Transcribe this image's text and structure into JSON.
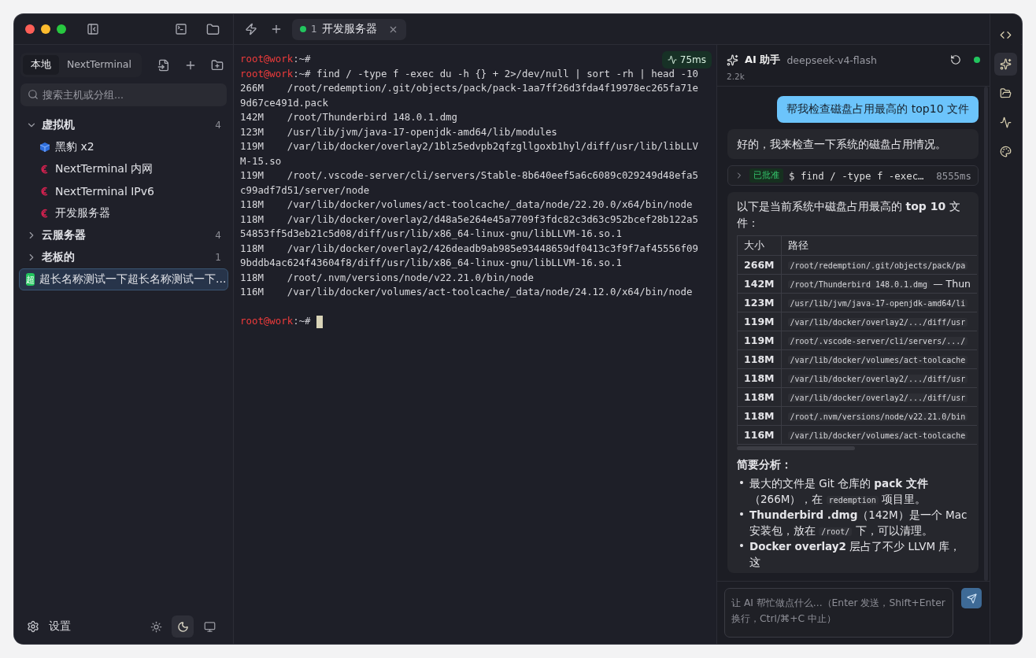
{
  "titlebar": {
    "tabs": [
      {
        "number": "1",
        "title": "开发服务器",
        "connected": true,
        "selected": true
      }
    ]
  },
  "sidebar": {
    "tabs": [
      {
        "label": "本地",
        "selected": true
      },
      {
        "label": "NextTerminal",
        "selected": false
      }
    ],
    "search": {
      "placeholder": "搜索主机或分组..."
    },
    "tree": [
      {
        "kind": "group",
        "label": "虚拟机",
        "count": "4",
        "expanded": true,
        "children": [
          {
            "kind": "cube",
            "label": "黑豹 x2",
            "selected": false
          },
          {
            "kind": "swirl",
            "label": "NextTerminal 内网",
            "selected": false
          },
          {
            "kind": "swirl",
            "label": "NextTerminal IPv6",
            "selected": false
          },
          {
            "kind": "swirl",
            "label": "开发服务器",
            "selected": false
          }
        ]
      },
      {
        "kind": "group",
        "label": "云服务器",
        "count": "4",
        "expanded": false
      },
      {
        "kind": "group",
        "label": "老板的",
        "count": "1",
        "expanded": false
      },
      {
        "kind": "badge",
        "badge": "超",
        "label": "超长名称测试一下超长名称测试一下...",
        "selected": true
      }
    ],
    "settings": "设置",
    "themes": [
      {
        "kind": "light",
        "selected": false
      },
      {
        "kind": "dark",
        "selected": true
      },
      {
        "kind": "system",
        "selected": false
      }
    ]
  },
  "terminal": {
    "latency": "75ms",
    "lines": [
      {
        "kind": "prompt",
        "user": "root@work",
        "path": ":~#"
      },
      {
        "kind": "prompt",
        "user": "root@work",
        "path": ":~#",
        "command": " find / -type f -exec du -h {} + 2>/dev/null | sort -rh | head -10"
      },
      {
        "kind": "output",
        "text": "266M    /root/redemption/.git/objects/pack/pack-1aa7ff26d3fda4f19978ec265fa71e"
      },
      {
        "kind": "output",
        "text": "9d67ce491d.pack"
      },
      {
        "kind": "output",
        "text": "142M    /root/Thunderbird 148.0.1.dmg"
      },
      {
        "kind": "output",
        "text": "123M    /usr/lib/jvm/java-17-openjdk-amd64/lib/modules"
      },
      {
        "kind": "output",
        "text": "119M    /var/lib/docker/overlay2/1blz5edvpb2qfzgllgoxb1hyl/diff/usr/lib/libLLV"
      },
      {
        "kind": "output",
        "text": "M-15.so"
      },
      {
        "kind": "output",
        "text": "119M    /root/.vscode-server/cli/servers/Stable-8b640eef5a6c6089c029249d48efa5"
      },
      {
        "kind": "output",
        "text": "c99adf7d51/server/node"
      },
      {
        "kind": "output",
        "text": "118M    /var/lib/docker/volumes/act-toolcache/_data/node/22.20.0/x64/bin/node"
      },
      {
        "kind": "output",
        "text": "118M    /var/lib/docker/overlay2/d48a5e264e45a7709f3fdc82c3d63c952bcef28b122a5"
      },
      {
        "kind": "output",
        "text": "54853ff5d3eb21c5d08/diff/usr/lib/x86_64-linux-gnu/libLLVM-16.so.1"
      },
      {
        "kind": "output",
        "text": "118M    /var/lib/docker/overlay2/426deadb9ab985e93448659df0413c3f9f7af45556f09"
      },
      {
        "kind": "output",
        "text": "9bddb4ac624f43604f8/diff/usr/lib/x86_64-linux-gnu/libLLVM-16.so.1"
      },
      {
        "kind": "output",
        "text": "118M    /root/.nvm/versions/node/v22.21.0/bin/node"
      },
      {
        "kind": "output",
        "text": "116M    /var/lib/docker/volumes/act-toolcache/_data/node/24.12.0/x64/bin/node"
      },
      {
        "kind": "blank"
      },
      {
        "kind": "prompt",
        "user": "root@work",
        "path": ":~#",
        "cursor": true
      }
    ]
  },
  "assistant": {
    "title": "AI 助手",
    "model": "deepseek-v4-flash",
    "online": true,
    "tokens": "2.2k",
    "messages": [
      {
        "kind": "user",
        "text": "帮我检查磁盘占用最高的 top10 文件"
      },
      {
        "kind": "assistant",
        "text": "好的，我来检查一下系统的磁盘占用情况。"
      },
      {
        "kind": "tool",
        "status": "已批准",
        "command": "$ find / -type f -exec…",
        "duration": "8555ms",
        "expanded": false
      },
      {
        "kind": "answer",
        "intro": "以下是当前系统中磁盘占用最高的 **top 10** 文件：",
        "table": {
          "columns": [
            "大小",
            "路径"
          ],
          "rows": [
            {
              "size": "266M",
              "path": "/root/redemption/.git/objects/pack/pa"
            },
            {
              "size": "142M",
              "path": "/root/Thunderbird 148.0.1.dmg",
              "note": "— Thun"
            },
            {
              "size": "123M",
              "path": "/usr/lib/jvm/java-17-openjdk-amd64/li"
            },
            {
              "size": "119M",
              "path": "/var/lib/docker/overlay2/.../diff/usr"
            },
            {
              "size": "119M",
              "path": "/root/.vscode-server/cli/servers/.../"
            },
            {
              "size": "118M",
              "path": "/var/lib/docker/volumes/act-toolcache"
            },
            {
              "size": "118M",
              "path": "/var/lib/docker/overlay2/.../diff/usr"
            },
            {
              "size": "118M",
              "path": "/var/lib/docker/overlay2/.../diff/usr"
            },
            {
              "size": "118M",
              "path": "/root/.nvm/versions/node/v22.21.0/bin"
            },
            {
              "size": "116M",
              "path": "/var/lib/docker/volumes/act-toolcache"
            }
          ]
        },
        "heading": "简要分析：",
        "bullets": [
          {
            "marker": "•",
            "parts": [
              {
                "text": "最大的文件是 Git 仓库的 **pack 文件**（266M），在 "
              },
              {
                "code": "redemption"
              },
              {
                "text": " 项目里。"
              }
            ]
          },
          {
            "marker": "•",
            "parts": [
              {
                "text": "**Thunderbird .dmg**（142M）是一个 Mac 安装包，放在 "
              },
              {
                "code": "/root/"
              },
              {
                "text": " 下，可以清理。"
              }
            ]
          },
          {
            "marker": "•",
            "parts": [
              {
                "text": "**Docker overlay2** 层占了不少 LLVM 库，这"
              }
            ]
          }
        ]
      }
    ],
    "input": {
      "placeholder": "让 AI 帮忙做点什么...（Enter 发送，Shift+Enter 换行，Ctrl/⌘+C 中止）"
    }
  },
  "rail": [
    {
      "kind": "code",
      "selected": false
    },
    {
      "kind": "sparkles",
      "selected": true
    },
    {
      "kind": "folder",
      "selected": false
    },
    {
      "kind": "activity",
      "selected": false
    },
    {
      "kind": "palette",
      "selected": false
    }
  ]
}
